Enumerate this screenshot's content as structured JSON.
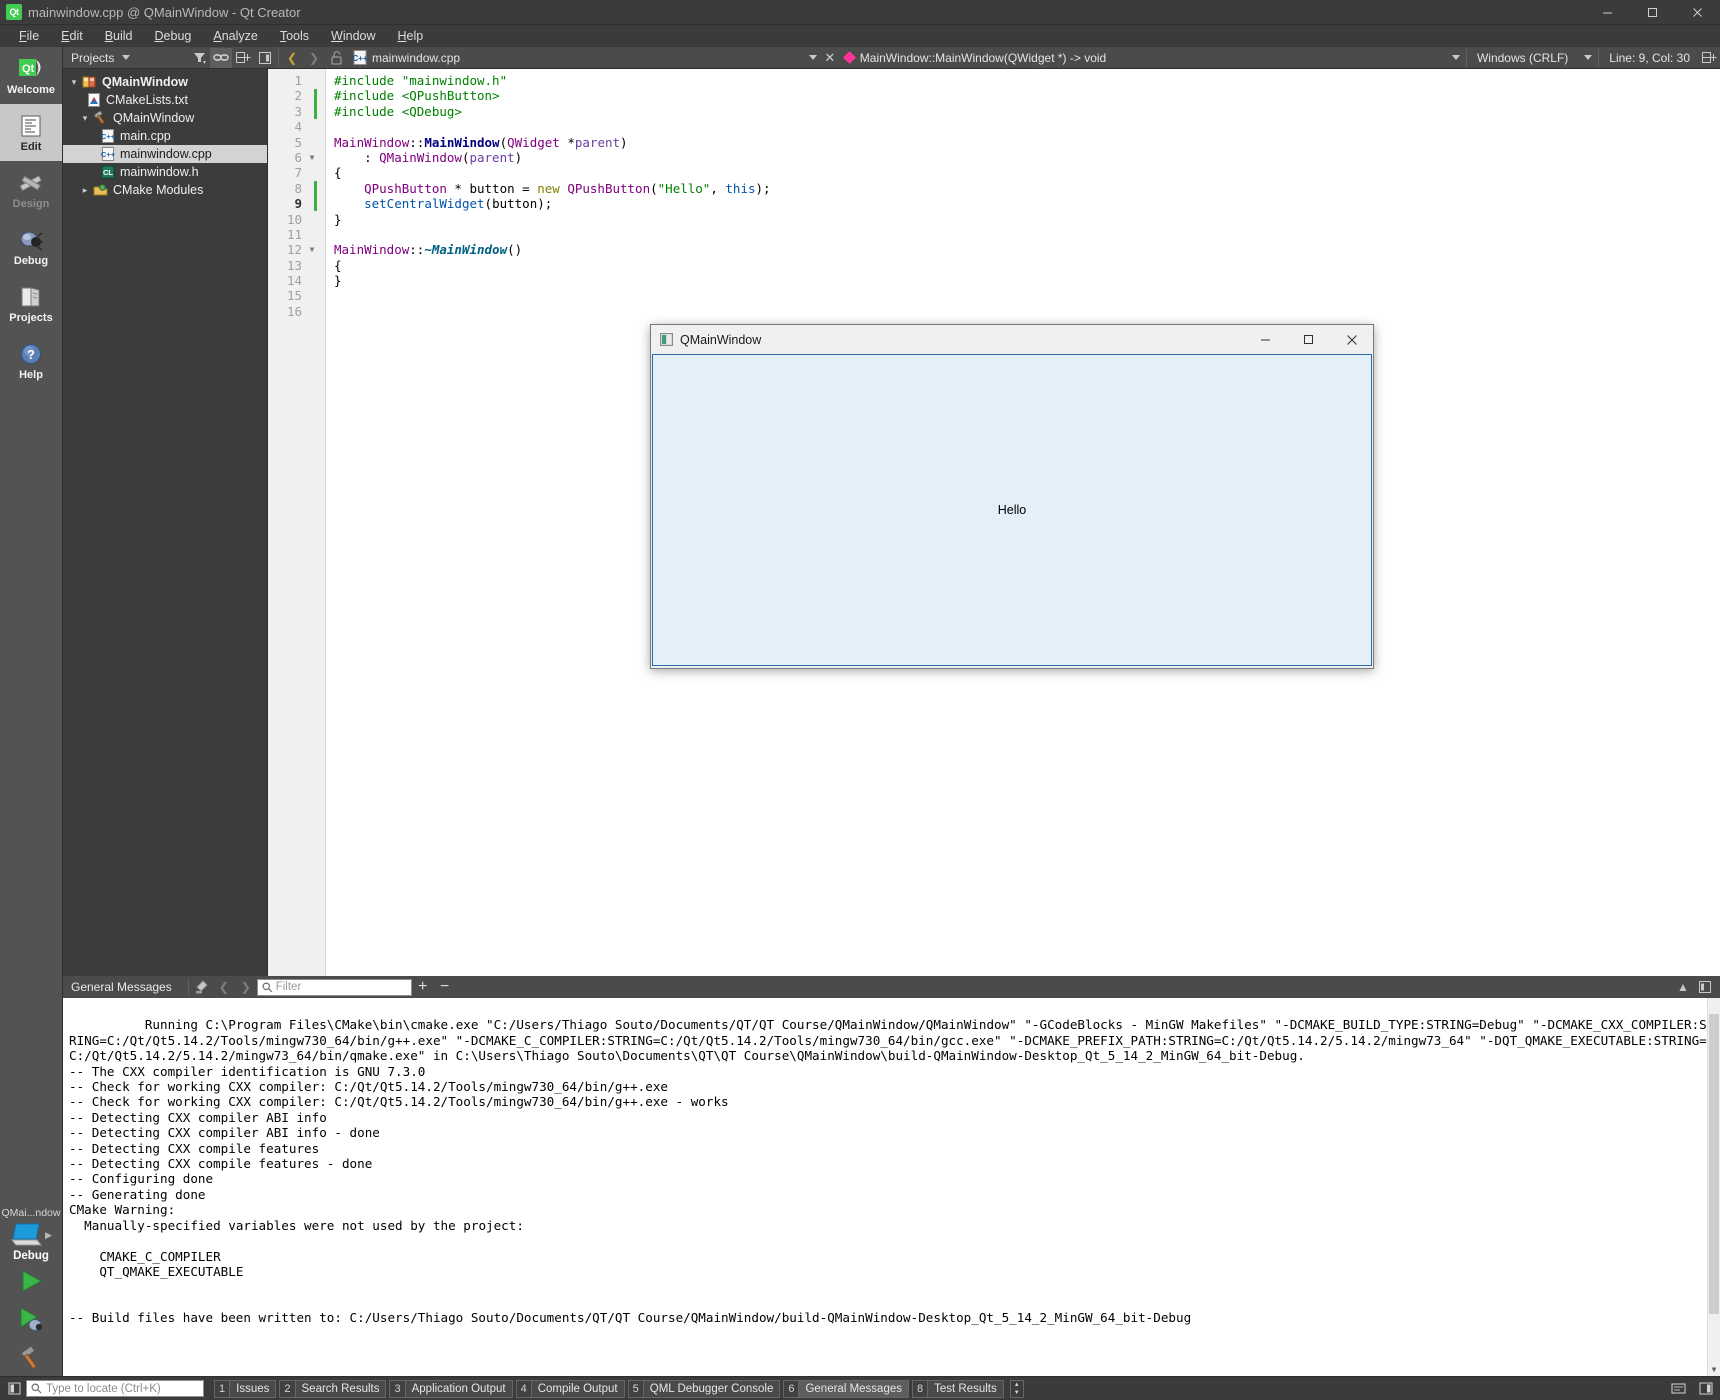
{
  "window": {
    "title": "mainwindow.cpp @ QMainWindow - Qt Creator",
    "logo_text": "Qt",
    "minimize": "—",
    "maximize": "❑",
    "close": "✕"
  },
  "menubar": [
    {
      "label": "File",
      "mnemonic": "F"
    },
    {
      "label": "Edit",
      "mnemonic": "E"
    },
    {
      "label": "Build",
      "mnemonic": "B"
    },
    {
      "label": "Debug",
      "mnemonic": "D"
    },
    {
      "label": "Analyze",
      "mnemonic": "A"
    },
    {
      "label": "Tools",
      "mnemonic": "T"
    },
    {
      "label": "Window",
      "mnemonic": "W"
    },
    {
      "label": "Help",
      "mnemonic": "H"
    }
  ],
  "modebar": {
    "items": [
      {
        "label": "Welcome",
        "icon": "qt-logo-icon",
        "state": "normal"
      },
      {
        "label": "Edit",
        "icon": "document-lines-icon",
        "state": "selected"
      },
      {
        "label": "Design",
        "icon": "ruler-pencil-icon",
        "state": "disabled"
      },
      {
        "label": "Debug",
        "icon": "bug-icon",
        "state": "normal"
      },
      {
        "label": "Projects",
        "icon": "folder-book-icon",
        "state": "normal"
      },
      {
        "label": "Help",
        "icon": "question-circle-icon",
        "state": "normal"
      }
    ],
    "kit": {
      "project_label": "QMai...ndow",
      "build_config": "Debug",
      "target_icon": "desktop-monitor-icon",
      "run_icon": "green-play-icon",
      "debug_icon": "play-bug-icon",
      "build_icon": "hammer-icon"
    }
  },
  "projects_panel": {
    "combo_label": "Projects",
    "buttons": [
      {
        "name": "filter-button",
        "icon": "funnel-icon"
      },
      {
        "name": "link-with-editor-button",
        "icon": "chain-link-icon"
      },
      {
        "name": "split-button",
        "icon": "split-plus-icon"
      },
      {
        "name": "close-sidebar-button",
        "icon": "panel-close-icon"
      }
    ],
    "tree": [
      {
        "depth": 0,
        "arrow": "expanded",
        "icon": "project-icon",
        "label": "QMainWindow",
        "bold": true,
        "selected": false
      },
      {
        "depth": 1,
        "arrow": "none",
        "icon": "cmake-file-icon",
        "label": "CMakeLists.txt",
        "bold": false,
        "selected": false
      },
      {
        "depth": 1,
        "arrow": "expanded",
        "icon": "hammer-target-icon",
        "label": "QMainWindow",
        "bold": false,
        "selected": false
      },
      {
        "depth": 2,
        "arrow": "none",
        "icon": "cpp-file-icon",
        "label": "main.cpp",
        "bold": false,
        "selected": false
      },
      {
        "depth": 2,
        "arrow": "none",
        "icon": "cpp-file-icon",
        "label": "mainwindow.cpp",
        "bold": false,
        "selected": true
      },
      {
        "depth": 2,
        "arrow": "none",
        "icon": "header-file-icon",
        "label": "mainwindow.h",
        "bold": false,
        "selected": false
      },
      {
        "depth": 1,
        "arrow": "collapsed",
        "icon": "cmake-modules-icon",
        "label": "CMake Modules",
        "bold": false,
        "selected": false
      }
    ]
  },
  "editor": {
    "nav_back_icon": "chevron-left-icon",
    "nav_forward_icon": "chevron-right-icon",
    "lock_icon": "unlocked-icon",
    "file_icon": "cpp-file-icon",
    "filename": "mainwindow.cpp",
    "close_label": "✕",
    "symbol": "MainWindow::MainWindow(QWidget *) -> void",
    "eol_setting": "Windows (CRLF)",
    "cursor_position": "Line: 9, Col: 30",
    "split_icon": "split-plus-icon",
    "total_lines": 16,
    "current_line": 9,
    "modified_lines": [
      2,
      3,
      8,
      9
    ],
    "fold_markers": [
      6,
      12
    ],
    "lines": [
      {
        "n": 1,
        "tokens": [
          {
            "t": "#include ",
            "c": "k-pre"
          },
          {
            "t": "\"mainwindow.h\"",
            "c": "k-str"
          }
        ]
      },
      {
        "n": 2,
        "tokens": [
          {
            "t": "#include ",
            "c": "k-pre"
          },
          {
            "t": "<QPushButton>",
            "c": "k-str"
          }
        ]
      },
      {
        "n": 3,
        "tokens": [
          {
            "t": "#include ",
            "c": "k-pre"
          },
          {
            "t": "<QDebug>",
            "c": "k-str"
          }
        ]
      },
      {
        "n": 4,
        "tokens": []
      },
      {
        "n": 5,
        "tokens": [
          {
            "t": "MainWindow",
            "c": "k-type"
          },
          {
            "t": "::",
            "c": "k-punc"
          },
          {
            "t": "MainWindow",
            "c": "k-func"
          },
          {
            "t": "(",
            "c": "k-punc"
          },
          {
            "t": "QWidget",
            "c": "k-type"
          },
          {
            "t": " *",
            "c": "k-punc"
          },
          {
            "t": "parent",
            "c": "k-param"
          },
          {
            "t": ")",
            "c": "k-punc"
          }
        ]
      },
      {
        "n": 6,
        "tokens": [
          {
            "t": "    : ",
            "c": "k-punc"
          },
          {
            "t": "QMainWindow",
            "c": "k-type"
          },
          {
            "t": "(",
            "c": "k-punc"
          },
          {
            "t": "parent",
            "c": "k-param"
          },
          {
            "t": ")",
            "c": "k-punc"
          }
        ]
      },
      {
        "n": 7,
        "tokens": [
          {
            "t": "{",
            "c": "k-punc"
          }
        ]
      },
      {
        "n": 8,
        "tokens": [
          {
            "t": "    ",
            "c": "k-punc"
          },
          {
            "t": "QPushButton",
            "c": "k-type"
          },
          {
            "t": " * ",
            "c": "k-punc"
          },
          {
            "t": "button",
            "c": "k-var"
          },
          {
            "t": " = ",
            "c": "k-punc"
          },
          {
            "t": "new",
            "c": "k-kw"
          },
          {
            "t": " ",
            "c": "k-punc"
          },
          {
            "t": "QPushButton",
            "c": "k-type"
          },
          {
            "t": "(",
            "c": "k-punc"
          },
          {
            "t": "\"Hello\"",
            "c": "k-str"
          },
          {
            "t": ", ",
            "c": "k-punc"
          },
          {
            "t": "this",
            "c": "k-fn2"
          },
          {
            "t": ");",
            "c": "k-punc"
          }
        ]
      },
      {
        "n": 9,
        "tokens": [
          {
            "t": "    ",
            "c": "k-punc"
          },
          {
            "t": "setCentralWidget",
            "c": "k-fn2"
          },
          {
            "t": "(",
            "c": "k-punc"
          },
          {
            "t": "button",
            "c": "k-var"
          },
          {
            "t": ");",
            "c": "k-punc"
          }
        ]
      },
      {
        "n": 10,
        "tokens": [
          {
            "t": "}",
            "c": "k-punc"
          }
        ]
      },
      {
        "n": 11,
        "tokens": []
      },
      {
        "n": 12,
        "tokens": [
          {
            "t": "MainWindow",
            "c": "k-type"
          },
          {
            "t": "::",
            "c": "k-punc"
          },
          {
            "t": "~MainWindow",
            "c": "k-dtor"
          },
          {
            "t": "()",
            "c": "k-punc"
          }
        ]
      },
      {
        "n": 13,
        "tokens": [
          {
            "t": "{",
            "c": "k-punc"
          }
        ]
      },
      {
        "n": 14,
        "tokens": [
          {
            "t": "}",
            "c": "k-punc"
          }
        ]
      },
      {
        "n": 15,
        "tokens": []
      },
      {
        "n": 16,
        "tokens": []
      }
    ]
  },
  "output_pane": {
    "title": "General Messages",
    "clear_icon": "clear-pane-icon",
    "prev_icon": "chevron-left-icon",
    "next_icon": "chevron-right-icon",
    "filter_placeholder": "Filter",
    "filter_value": "",
    "filter_icon": "search-icon",
    "zoom_in": "+",
    "zoom_out": "−",
    "maximize_icon": "chevron-up-icon",
    "close_icon": "panel-close-icon",
    "text": "Running C:\\Program Files\\CMake\\bin\\cmake.exe \"C:/Users/Thiago Souto/Documents/QT/QT Course/QMainWindow/QMainWindow\" \"-GCodeBlocks - MinGW Makefiles\" \"-DCMAKE_BUILD_TYPE:STRING=Debug\" \"-DCMAKE_CXX_COMPILER:STRING=C:/Qt/Qt5.14.2/Tools/mingw730_64/bin/g++.exe\" \"-DCMAKE_C_COMPILER:STRING=C:/Qt/Qt5.14.2/Tools/mingw730_64/bin/gcc.exe\" \"-DCMAKE_PREFIX_PATH:STRING=C:/Qt/Qt5.14.2/5.14.2/mingw73_64\" \"-DQT_QMAKE_EXECUTABLE:STRING=C:/Qt/Qt5.14.2/5.14.2/mingw73_64/bin/qmake.exe\" in C:\\Users\\Thiago Souto\\Documents\\QT\\QT Course\\QMainWindow\\build-QMainWindow-Desktop_Qt_5_14_2_MinGW_64_bit-Debug.\n-- The CXX compiler identification is GNU 7.3.0\n-- Check for working CXX compiler: C:/Qt/Qt5.14.2/Tools/mingw730_64/bin/g++.exe\n-- Check for working CXX compiler: C:/Qt/Qt5.14.2/Tools/mingw730_64/bin/g++.exe - works\n-- Detecting CXX compiler ABI info\n-- Detecting CXX compiler ABI info - done\n-- Detecting CXX compile features\n-- Detecting CXX compile features - done\n-- Configuring done\n-- Generating done\nCMake Warning:\n  Manually-specified variables were not used by the project:\n\n    CMAKE_C_COMPILER\n    QT_QMAKE_EXECUTABLE\n\n\n-- Build files have been written to: C:/Users/Thiago Souto/Documents/QT/QT Course/QMainWindow/build-QMainWindow-Desktop_Qt_5_14_2_MinGW_64_bit-Debug"
  },
  "statusbar": {
    "sidebar_toggle_icon": "sidebar-toggle-icon",
    "locator_placeholder": "Type to locate (Ctrl+K)",
    "locator_value": "",
    "locator_icon": "search-icon",
    "tabs": [
      {
        "num": "1",
        "label": "Issues",
        "active": false
      },
      {
        "num": "2",
        "label": "Search Results",
        "active": false
      },
      {
        "num": "3",
        "label": "Application Output",
        "active": false
      },
      {
        "num": "4",
        "label": "Compile Output",
        "active": false
      },
      {
        "num": "5",
        "label": "QML Debugger Console",
        "active": false
      },
      {
        "num": "6",
        "label": "General Messages",
        "active": true
      },
      {
        "num": "8",
        "label": "Test Results",
        "active": false
      }
    ],
    "right_icons": [
      {
        "name": "progress-details-icon"
      },
      {
        "name": "panel-close-icon"
      }
    ]
  },
  "app_window": {
    "title": "QMainWindow",
    "icon": "qt-app-icon",
    "minimize": "—",
    "maximize": "❑",
    "close": "✕",
    "button_text": "Hello",
    "button_bg": "#e3eff9",
    "button_border": "#2d6ca8"
  },
  "colors": {
    "accent_green": "#41cd52",
    "chrome_dark": "#3b3b3b",
    "chrome_mid": "#4b4b4b",
    "mode_bar": "#535353",
    "selection": "#d3d3d3",
    "symbol_pink": "#ff3399",
    "modified_marker": "#3cb043"
  }
}
